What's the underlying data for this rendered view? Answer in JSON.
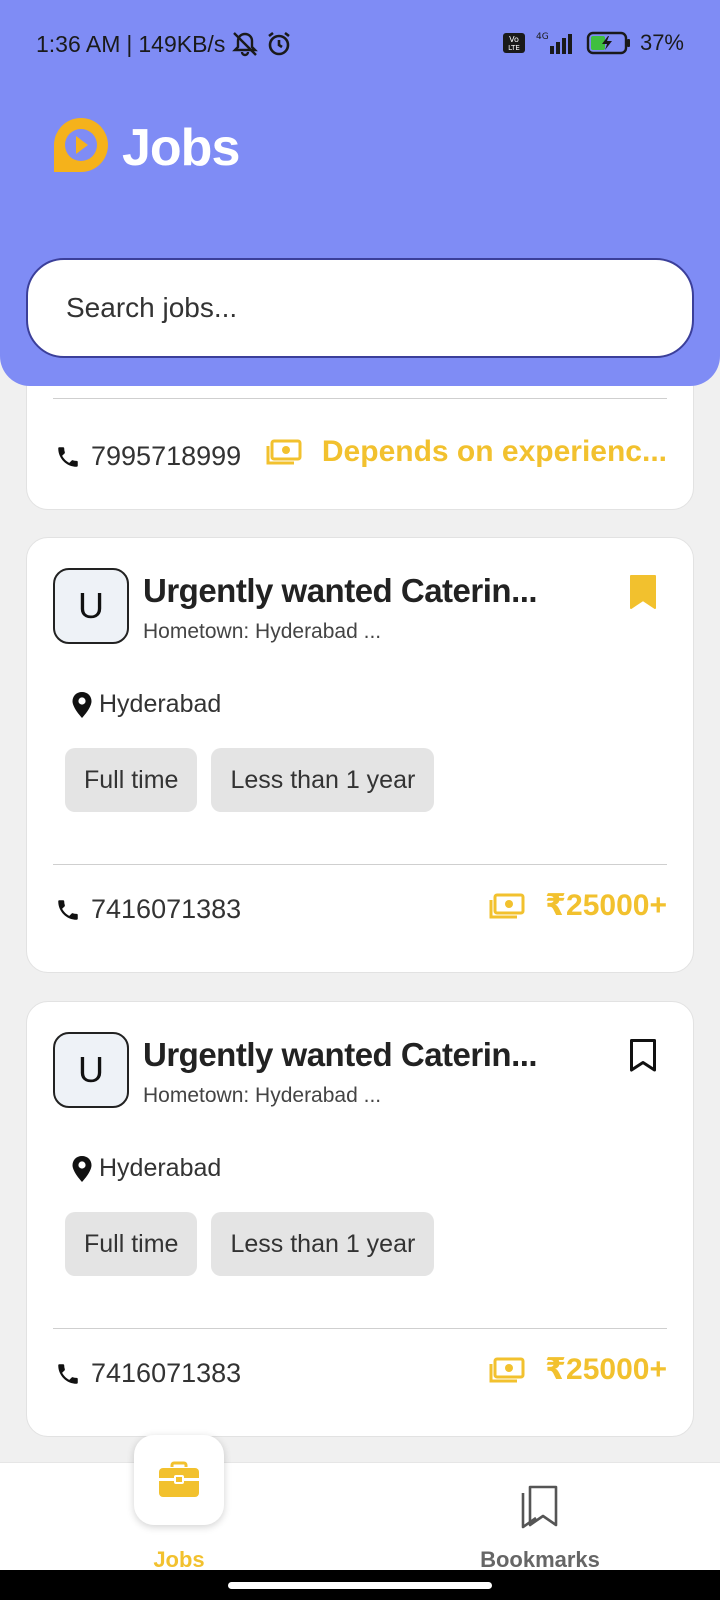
{
  "status_bar": {
    "time": "1:36 AM",
    "speed": "149KB/s",
    "network": "4G",
    "battery": "37%"
  },
  "header": {
    "title": "Jobs",
    "logo_icon": "play-circle-icon",
    "background": "#7f8cf5"
  },
  "search": {
    "placeholder": "Search jobs..."
  },
  "jobs": [
    {
      "phone": "7995718999",
      "salary": "Depends on experienc..."
    },
    {
      "avatar": "U",
      "title": "Urgently wanted Caterin...",
      "subtitle": "Hometown: Hyderabad ...",
      "bookmarked": true,
      "location": "Hyderabad",
      "tags": [
        "Full time",
        "Less than 1 year"
      ],
      "phone": "7416071383",
      "salary": "₹25000+"
    },
    {
      "avatar": "U",
      "title": "Urgently wanted Caterin...",
      "subtitle": "Hometown: Hyderabad ...",
      "bookmarked": false,
      "location": "Hyderabad",
      "tags": [
        "Full time",
        "Less than 1 year"
      ],
      "phone": "7416071383",
      "salary": "₹25000+"
    }
  ],
  "bottom_nav": {
    "items": [
      {
        "label": "Jobs",
        "icon": "briefcase-icon",
        "active": true
      },
      {
        "label": "Bookmarks",
        "icon": "bookmarks-icon",
        "active": false
      }
    ]
  },
  "colors": {
    "accent": "#f2c12e",
    "header": "#7f8cf5"
  }
}
